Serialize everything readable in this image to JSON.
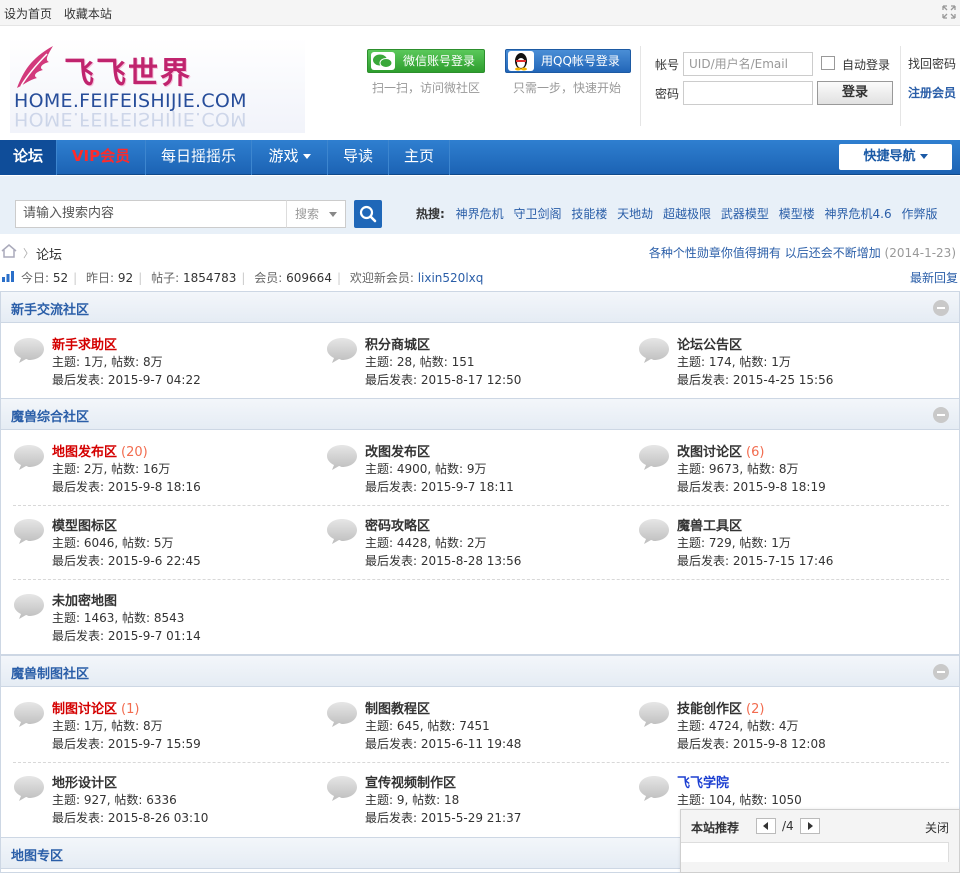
{
  "toolbar": {
    "set_home": "设为首页",
    "favorite": "收藏本站"
  },
  "header": {
    "logo_cn": "飞飞世界",
    "logo_en": "HOME.FEIFEISHIJIE.COM",
    "wechat_login": "微信账号登录",
    "wechat_note": "扫一扫，访问微社区",
    "qq_login": "用QQ帐号登录",
    "qq_note": "只需一步，快速开始",
    "account_label": "帐号",
    "password_label": "密码",
    "account_placeholder": "UID/用户名/Email",
    "auto_login": "自动登录",
    "login_button": "登录",
    "forgot_password": "找回密码",
    "register": "注册会员"
  },
  "nav": {
    "items": [
      "论坛",
      "VIP会员",
      "每日摇摇乐",
      "游戏",
      "导读",
      "主页"
    ],
    "quick_nav": "快捷导航"
  },
  "search": {
    "placeholder": "请输入搜索内容",
    "type": "搜索",
    "hot_label": "热搜:",
    "hot_words": [
      "神界危机",
      "守卫剑阁",
      "技能楼",
      "天地劫",
      "超越极限",
      "武器模型",
      "模型楼",
      "神界危机4.6",
      "作弊版"
    ]
  },
  "breadcrumb": {
    "current": "论坛",
    "notice": "各种个性勋章你值得拥有 以后还会不断增加",
    "notice_date": "(2014-1-23)"
  },
  "stats": {
    "today_label": "今日:",
    "today": "52",
    "yesterday_label": "昨日:",
    "yesterday": "92",
    "posts_label": "帖子:",
    "posts": "1854783",
    "members_label": "会员:",
    "members": "609664",
    "welcome_label": "欢迎新会员:",
    "new_member": "lixin520lxq",
    "latest_reply": "最新回复"
  },
  "groups": [
    {
      "title": "新手交流社区",
      "forums": [
        {
          "name": "新手求助区",
          "color": "red",
          "today": "",
          "stat": "主题: 1万, 帖数: 8万",
          "last": "最后发表: 2015-9-7 04:22"
        },
        {
          "name": "积分商城区",
          "color": "",
          "today": "",
          "stat": "主题: 28, 帖数: 151",
          "last": "最后发表: 2015-8-17 12:50"
        },
        {
          "name": "论坛公告区",
          "color": "",
          "today": "",
          "stat": "主题: 174, 帖数: 1万",
          "last": "最后发表: 2015-4-25 15:56"
        }
      ]
    },
    {
      "title": "魔兽综合社区",
      "forums": [
        {
          "name": "地图发布区",
          "color": "red",
          "today": "(20)",
          "stat": "主题: 2万, 帖数: 16万",
          "last": "最后发表: 2015-9-8 18:16"
        },
        {
          "name": "改图发布区",
          "color": "",
          "today": "",
          "stat": "主题: 4900, 帖数: 9万",
          "last": "最后发表: 2015-9-7 18:11"
        },
        {
          "name": "改图讨论区",
          "color": "",
          "today": "(6)",
          "stat": "主题: 9673, 帖数: 8万",
          "last": "最后发表: 2015-9-8 18:19"
        },
        {
          "name": "模型图标区",
          "color": "",
          "today": "",
          "stat": "主题: 6046, 帖数: 5万",
          "last": "最后发表: 2015-9-6 22:45"
        },
        {
          "name": "密码攻略区",
          "color": "",
          "today": "",
          "stat": "主题: 4428, 帖数: 2万",
          "last": "最后发表: 2015-8-28 13:56"
        },
        {
          "name": "魔兽工具区",
          "color": "",
          "today": "",
          "stat": "主题: 729, 帖数: 1万",
          "last": "最后发表: 2015-7-15 17:46"
        },
        {
          "name": "未加密地图",
          "color": "",
          "today": "",
          "stat": "主题: 1463, 帖数: 8543",
          "last": "最后发表: 2015-9-7 01:14"
        }
      ]
    },
    {
      "title": "魔兽制图社区",
      "forums": [
        {
          "name": "制图讨论区",
          "color": "red",
          "today": "(1)",
          "stat": "主题: 1万, 帖数: 8万",
          "last": "最后发表: 2015-9-7 15:59"
        },
        {
          "name": "制图教程区",
          "color": "",
          "today": "",
          "stat": "主题: 645, 帖数: 7451",
          "last": "最后发表: 2015-6-11 19:48"
        },
        {
          "name": "技能创作区",
          "color": "",
          "today": "(2)",
          "stat": "主题: 4724, 帖数: 4万",
          "last": "最后发表: 2015-9-8 12:08"
        },
        {
          "name": "地形设计区",
          "color": "",
          "today": "",
          "stat": "主题: 927, 帖数: 6336",
          "last": "最后发表: 2015-8-26 03:10"
        },
        {
          "name": "宣传视频制作区",
          "color": "",
          "today": "",
          "stat": "主题: 9, 帖数: 18",
          "last": "最后发表: 2015-5-29 21:37"
        },
        {
          "name": "飞飞学院",
          "color": "blue",
          "today": "",
          "stat": "主题: 104, 帖数: 1050",
          "last": ""
        }
      ]
    },
    {
      "title": "地图专区",
      "forums": []
    }
  ],
  "popup": {
    "title": "本站推荐",
    "pager": "/4",
    "close": "关闭"
  }
}
